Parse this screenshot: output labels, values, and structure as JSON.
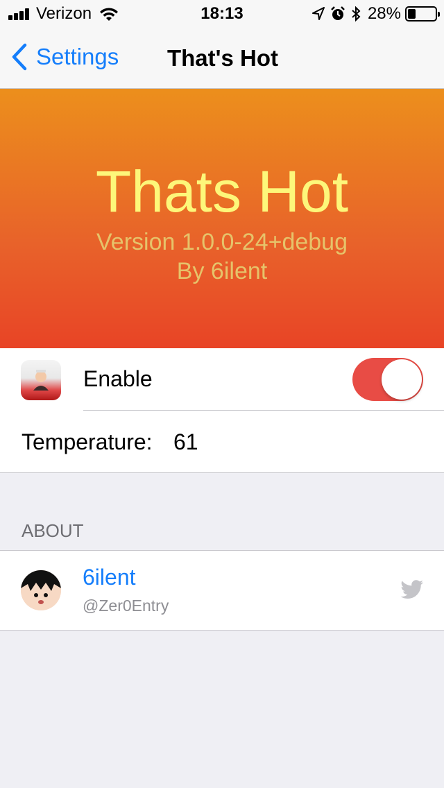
{
  "status_bar": {
    "carrier": "Verizon",
    "time": "18:13",
    "battery_percent": "28%",
    "battery_level": 0.28,
    "icons": [
      "signal-icon",
      "wifi-icon",
      "location-icon",
      "alarm-icon",
      "bluetooth-icon",
      "battery-icon"
    ]
  },
  "nav": {
    "back_label": "Settings",
    "title": "That's Hot"
  },
  "banner": {
    "title": "Thats Hot",
    "version": "Version 1.0.0-24+debug",
    "author": "By 6ilent",
    "colors": {
      "top": "#ec8f1c",
      "bottom": "#e84426",
      "title": "#fdf77a",
      "subtitle": "#e6c36a"
    }
  },
  "settings": {
    "enable_label": "Enable",
    "enable_on": true,
    "temperature_label": "Temperature:",
    "temperature_value": "61"
  },
  "about": {
    "header": "ABOUT",
    "name": "6ilent",
    "handle": "@Zer0Entry",
    "icon": "twitter-icon"
  },
  "colors": {
    "accent": "#157efb",
    "toggle_on": "#e84c45",
    "background": "#efeff4"
  }
}
